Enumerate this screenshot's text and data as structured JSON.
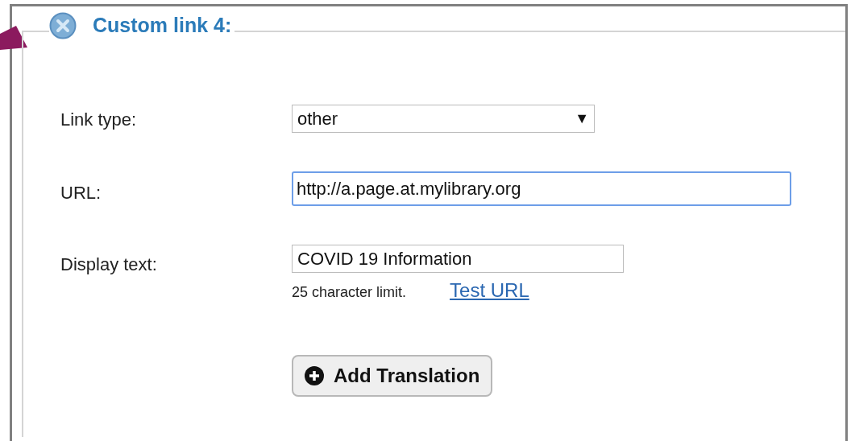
{
  "section": {
    "title": "Custom link 4:"
  },
  "fields": [
    {
      "kind": "select",
      "label": "Link type:",
      "value": "other",
      "caret": "▼",
      "focused": false
    },
    {
      "kind": "text",
      "label": "URL:",
      "value": "http://a.page.at.mylibrary.org",
      "focused": true
    },
    {
      "kind": "text",
      "label": "Display text:",
      "value": "COVID 19 Information",
      "focused": false,
      "hint": "25 character limit.",
      "link": "Test URL"
    }
  ],
  "button": {
    "label": "Add Translation"
  }
}
